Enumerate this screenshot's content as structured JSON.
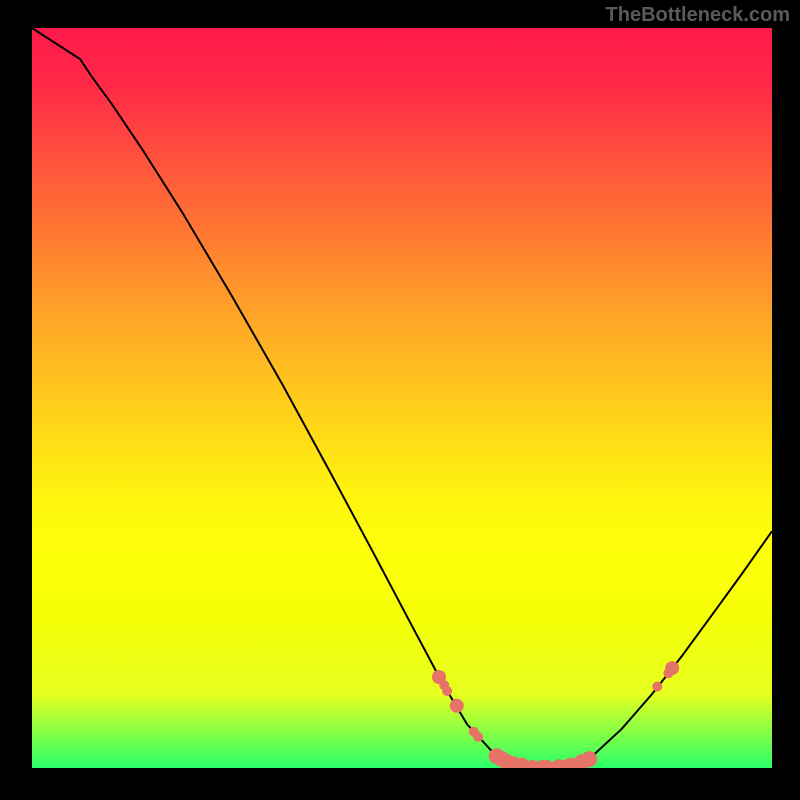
{
  "watermark": "TheBottleneck.com",
  "chart_data": {
    "type": "line",
    "title": "",
    "xlabel": "",
    "ylabel": "",
    "xlim": [
      0,
      100
    ],
    "ylim": [
      0,
      100
    ],
    "grid": false,
    "annotations": [],
    "curve": [
      {
        "x": 0.0,
        "y": 100.0
      },
      {
        "x": 6.5,
        "y": 95.8
      },
      {
        "x": 8.1,
        "y": 93.4
      },
      {
        "x": 10.8,
        "y": 89.7
      },
      {
        "x": 14.9,
        "y": 83.6
      },
      {
        "x": 20.3,
        "y": 75.1
      },
      {
        "x": 27.0,
        "y": 63.8
      },
      {
        "x": 33.8,
        "y": 51.9
      },
      {
        "x": 40.5,
        "y": 39.6
      },
      {
        "x": 45.9,
        "y": 29.5
      },
      {
        "x": 51.4,
        "y": 19.1
      },
      {
        "x": 55.4,
        "y": 11.6
      },
      {
        "x": 58.8,
        "y": 5.9
      },
      {
        "x": 62.2,
        "y": 2.2
      },
      {
        "x": 64.9,
        "y": 0.7
      },
      {
        "x": 67.5,
        "y": 0.0
      },
      {
        "x": 70.3,
        "y": 0.0
      },
      {
        "x": 73.0,
        "y": 0.3
      },
      {
        "x": 75.7,
        "y": 1.6
      },
      {
        "x": 79.7,
        "y": 5.3
      },
      {
        "x": 83.8,
        "y": 10.0
      },
      {
        "x": 87.8,
        "y": 15.1
      },
      {
        "x": 91.9,
        "y": 20.7
      },
      {
        "x": 95.9,
        "y": 26.2
      },
      {
        "x": 100.0,
        "y": 32.0
      }
    ],
    "markers": [
      {
        "x": 55.0,
        "y": 12.3
      },
      {
        "x": 55.7,
        "y": 11.2
      },
      {
        "x": 56.1,
        "y": 10.4
      },
      {
        "x": 57.4,
        "y": 8.4
      },
      {
        "x": 59.7,
        "y": 4.9
      },
      {
        "x": 60.3,
        "y": 4.2
      },
      {
        "x": 62.8,
        "y": 1.6
      },
      {
        "x": 63.5,
        "y": 1.2
      },
      {
        "x": 64.2,
        "y": 0.8
      },
      {
        "x": 65.1,
        "y": 0.5
      },
      {
        "x": 66.2,
        "y": 0.3
      },
      {
        "x": 67.6,
        "y": 0.0
      },
      {
        "x": 68.9,
        "y": 0.0
      },
      {
        "x": 69.6,
        "y": 0.0
      },
      {
        "x": 71.2,
        "y": 0.1
      },
      {
        "x": 72.3,
        "y": 0.1
      },
      {
        "x": 72.8,
        "y": 0.3
      },
      {
        "x": 74.3,
        "y": 0.8
      },
      {
        "x": 75.3,
        "y": 1.2
      },
      {
        "x": 84.5,
        "y": 11.0
      },
      {
        "x": 86.0,
        "y": 12.8
      },
      {
        "x": 86.5,
        "y": 13.5
      }
    ],
    "style": {
      "curve_color": "#000000",
      "curve_width": 2,
      "marker_color": "#e57368",
      "marker_radius_small": 5,
      "marker_radius_large": 8,
      "background_gradient": [
        "#ff1a4c",
        "#2aff68"
      ]
    }
  }
}
